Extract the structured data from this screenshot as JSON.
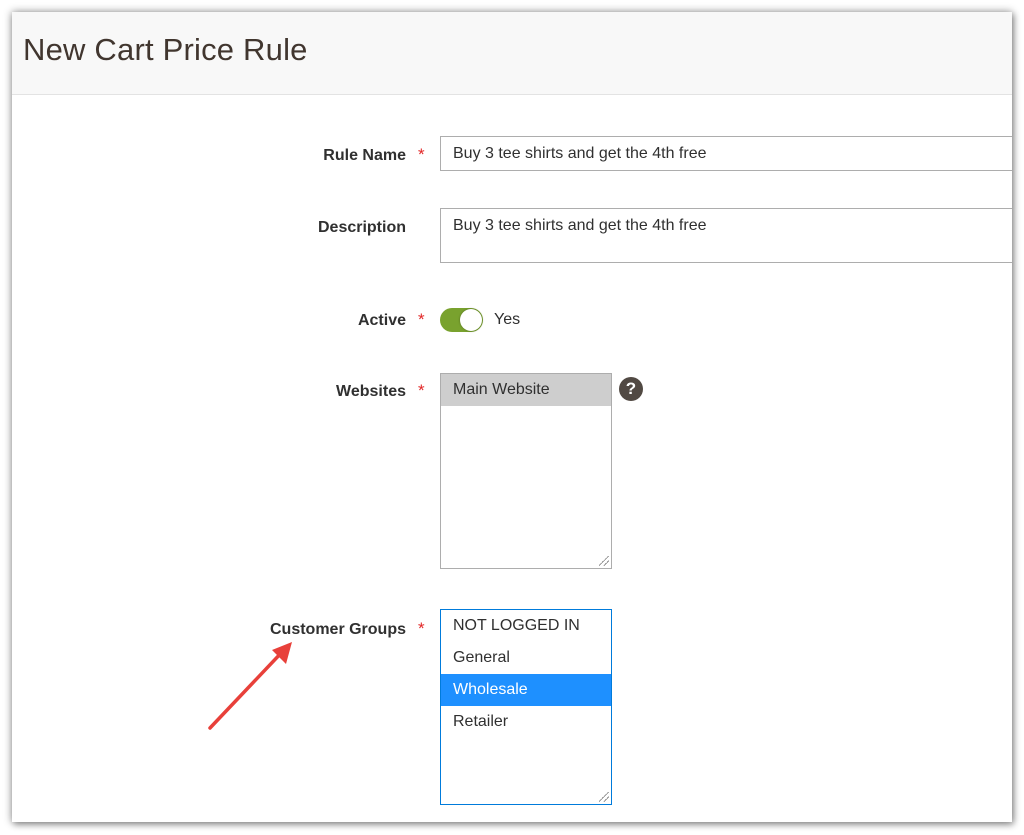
{
  "page": {
    "title": "New Cart Price Rule"
  },
  "form": {
    "rule_name": {
      "label": "Rule Name",
      "required_mark": "*",
      "value": "Buy 3 tee shirts and get the 4th free"
    },
    "description": {
      "label": "Description",
      "value": "Buy 3 tee shirts and get the 4th free"
    },
    "active": {
      "label": "Active",
      "required_mark": "*",
      "state_text": "Yes",
      "on": true
    },
    "websites": {
      "label": "Websites",
      "required_mark": "*",
      "options": [
        "Main Website"
      ],
      "selected": "Main Website",
      "help_icon": "question-circle-icon",
      "help_glyph": "?"
    },
    "customer_groups": {
      "label": "Customer Groups",
      "required_mark": "*",
      "options": [
        "NOT LOGGED IN",
        "General",
        "Wholesale",
        "Retailer"
      ],
      "selected": "Wholesale"
    }
  },
  "annotation": {
    "arrow_icon": "red-arrow-icon",
    "arrow_color": "#e8403a"
  },
  "colors": {
    "accent_blue": "#1e90ff",
    "toggle_green": "#79a22e",
    "required_red": "#e22626"
  }
}
